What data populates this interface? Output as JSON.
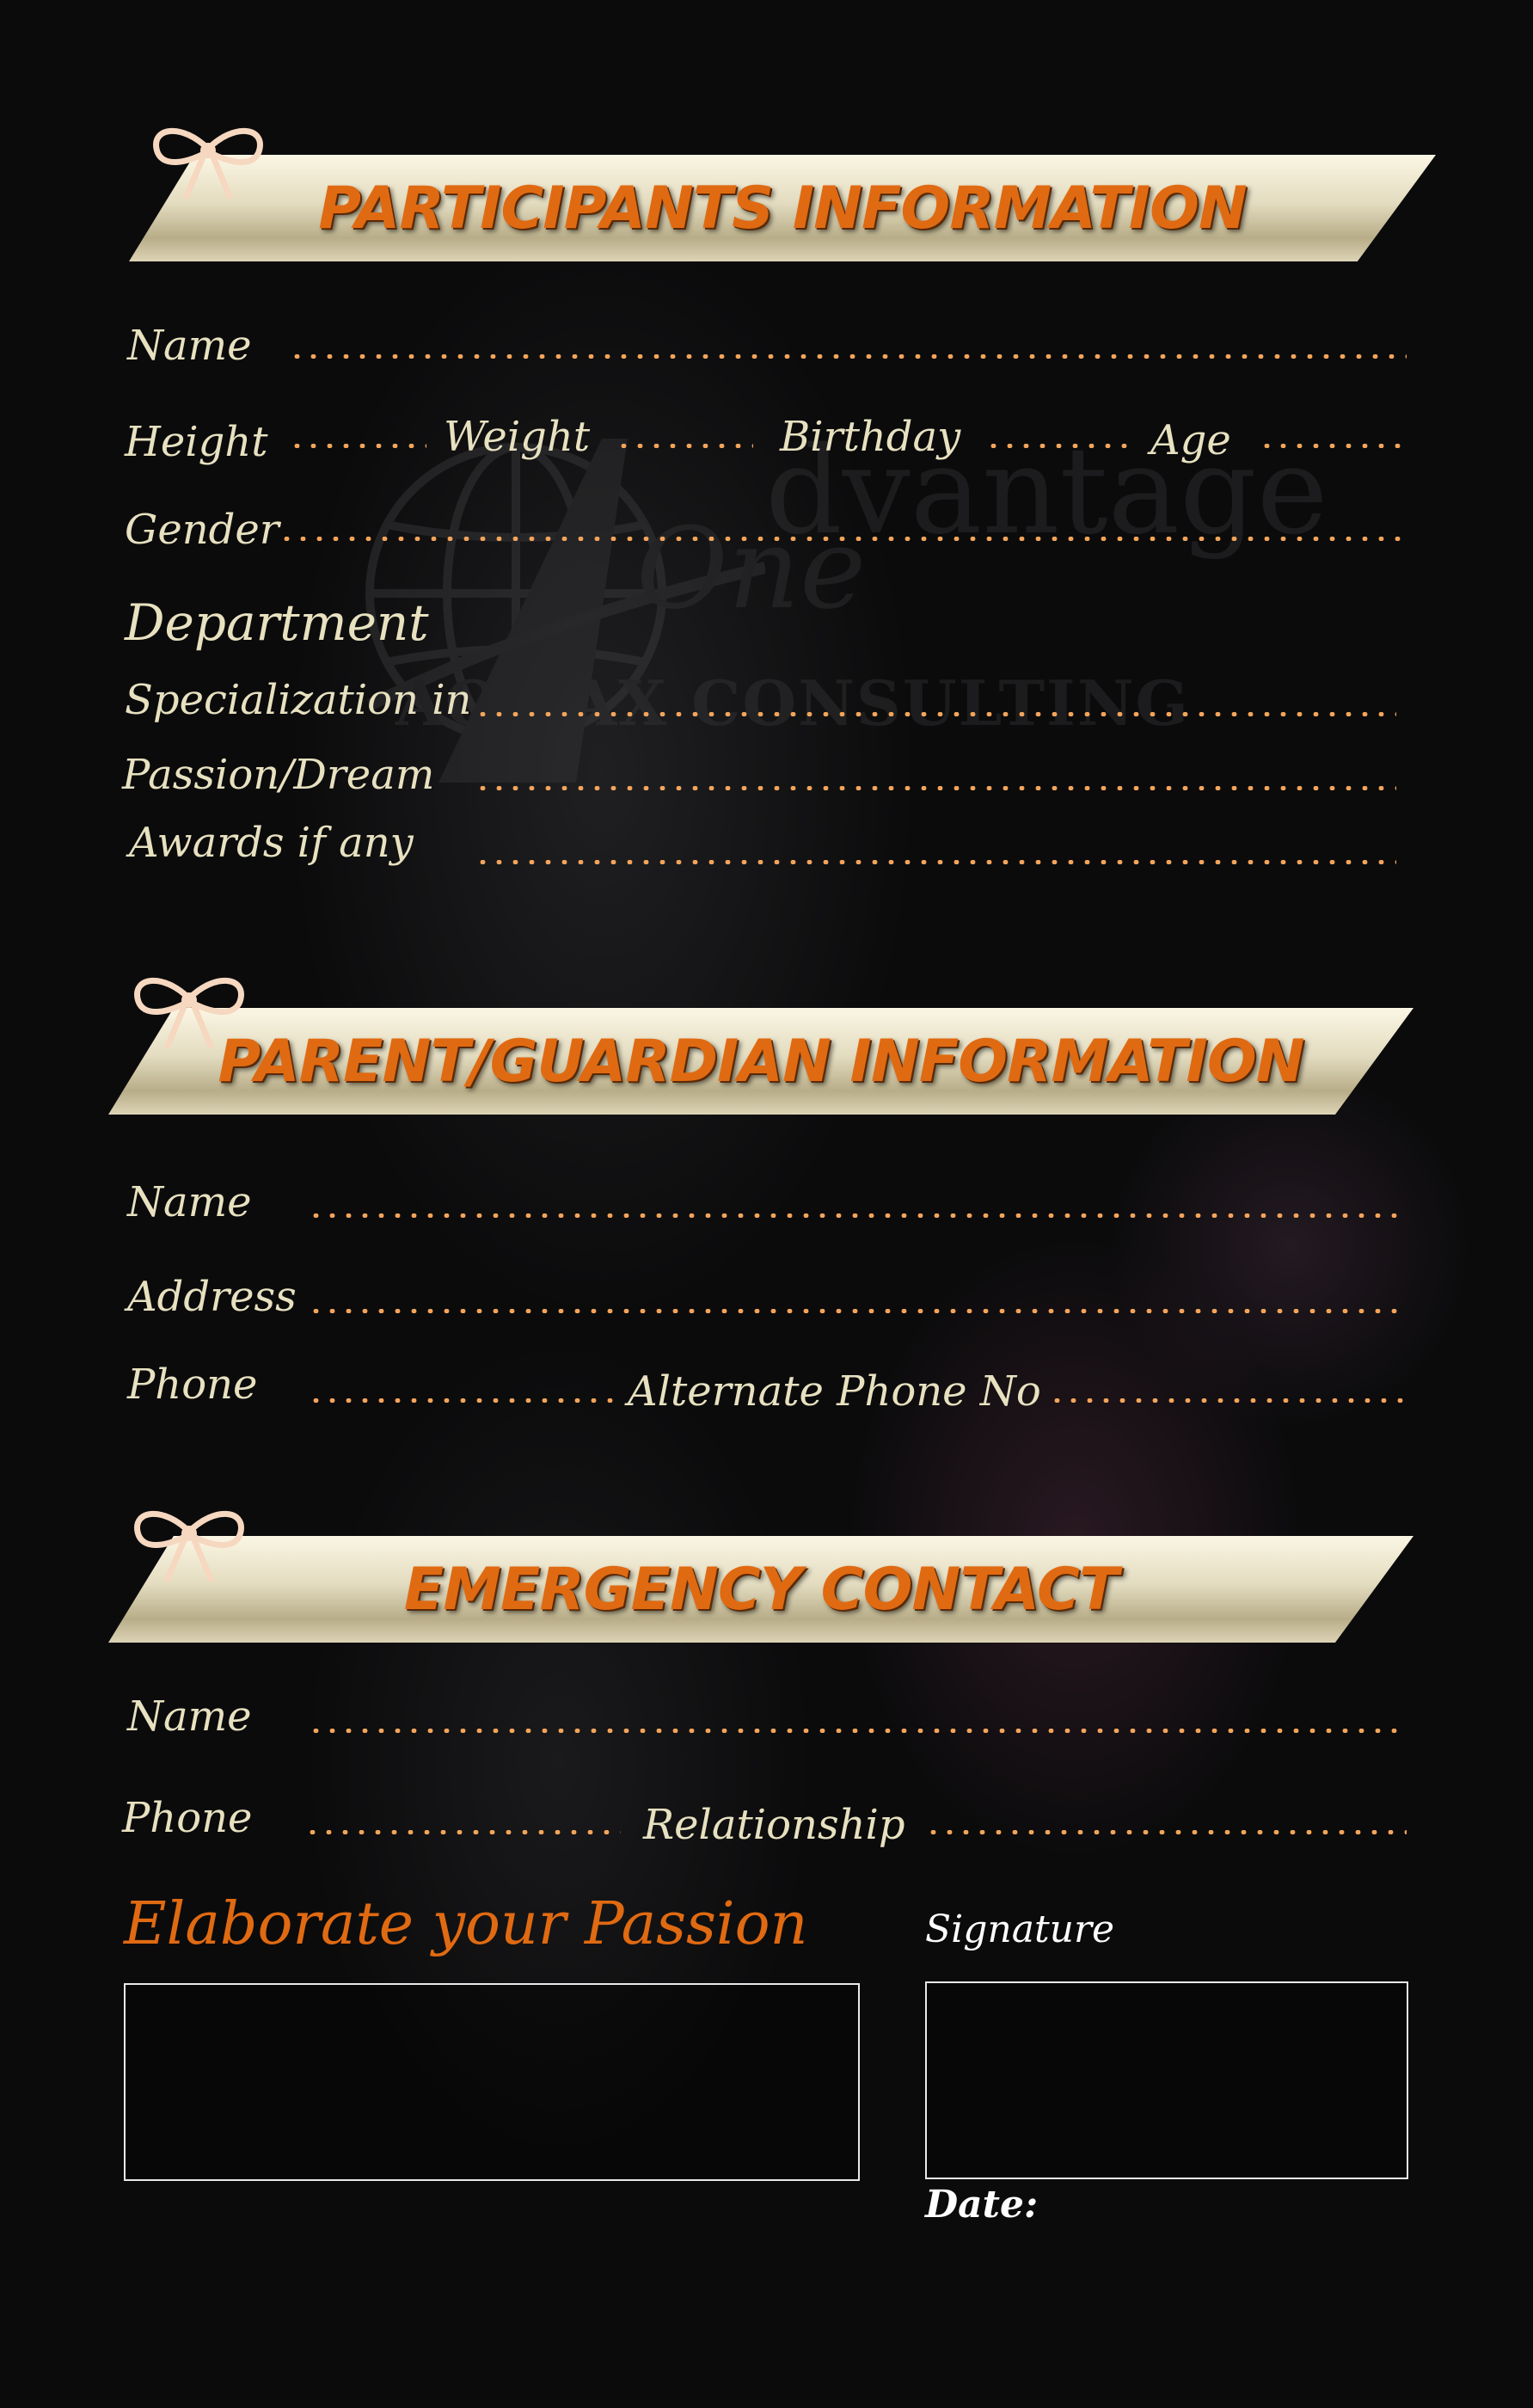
{
  "participants": {
    "title": "PARTICIPANTS INFORMATION",
    "name": "Name",
    "height": "Height",
    "weight": "Weight",
    "birthday": "Birthday",
    "age": "Age",
    "gender": "Gender",
    "department": "Department",
    "specialization": "Specialization in",
    "passion": "Passion/Dream",
    "awards": "Awards if any"
  },
  "guardian": {
    "title": "PARENT/GUARDIAN INFORMATION",
    "name": "Name",
    "address": "Address",
    "phone": "Phone",
    "alt_phone": "Alternate Phone No"
  },
  "emergency": {
    "title": "EMERGENCY CONTACT",
    "name": "Name",
    "phone": "Phone",
    "relationship": "Relationship"
  },
  "footer": {
    "elaborate": "Elaborate your Passion",
    "signature": "Signature",
    "date": "Date:"
  },
  "watermark": {
    "brand_line1": "dvantage",
    "brand_line2": "One",
    "company": "AO TAX CONSULTING"
  },
  "colors": {
    "accent": "#e06a12",
    "label": "#e7e1c0",
    "dots": "#f3a45a",
    "background": "#0b0b0c"
  },
  "icons": [
    "bow-icon",
    "globe-logo-icon"
  ]
}
